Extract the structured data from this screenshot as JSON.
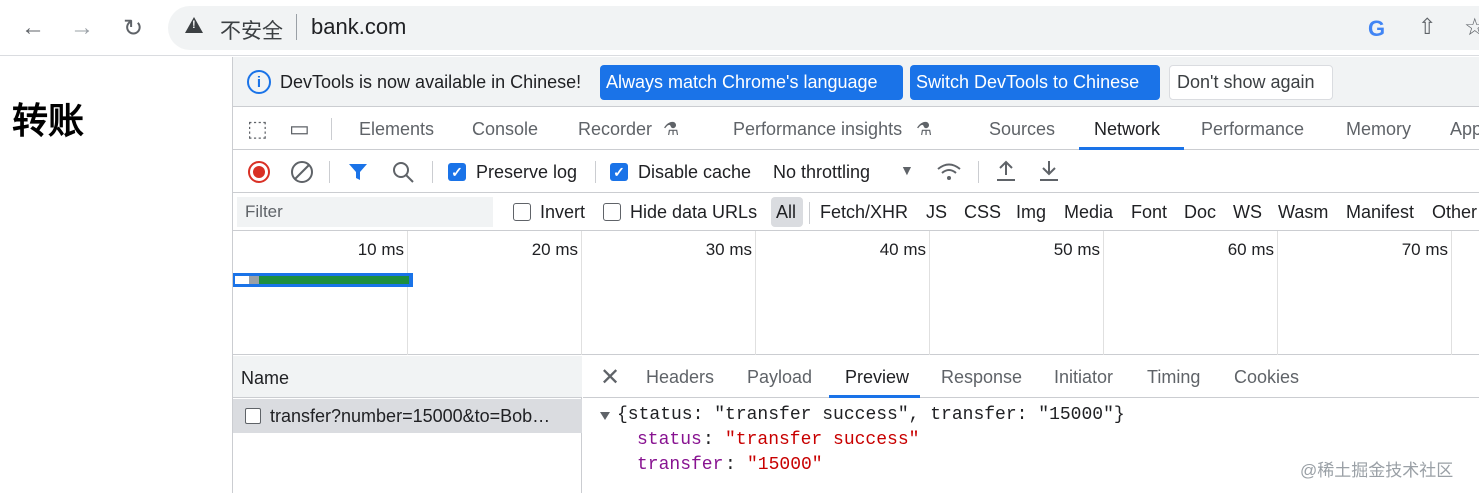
{
  "browser": {
    "security_label": "不安全",
    "url": "bank.com"
  },
  "page": {
    "title": "转账"
  },
  "devtools": {
    "infobar": {
      "message": "DevTools is now available in Chinese!",
      "btn_match": "Always match Chrome's language",
      "btn_switch": "Switch DevTools to Chinese",
      "btn_dismiss": "Don't show again"
    },
    "tabs": [
      "Elements",
      "Console",
      "Recorder",
      "Performance insights",
      "Sources",
      "Network",
      "Performance",
      "Memory",
      "App"
    ],
    "active_tab": "Network",
    "network_toolbar": {
      "preserve_log": "Preserve log",
      "disable_cache": "Disable cache",
      "throttling": "No throttling"
    },
    "filter": {
      "placeholder": "Filter",
      "invert": "Invert",
      "hide_data_urls": "Hide data URLs",
      "types": [
        "All",
        "Fetch/XHR",
        "JS",
        "CSS",
        "Img",
        "Media",
        "Font",
        "Doc",
        "WS",
        "Wasm",
        "Manifest",
        "Other"
      ]
    },
    "timeline": {
      "ticks": [
        "10 ms",
        "20 ms",
        "30 ms",
        "40 ms",
        "50 ms",
        "60 ms",
        "70 ms"
      ]
    },
    "requests": {
      "column_name": "Name",
      "rows": [
        {
          "name": "transfer?number=15000&to=Bob…"
        }
      ]
    },
    "detail": {
      "tabs": [
        "Headers",
        "Payload",
        "Preview",
        "Response",
        "Initiator",
        "Timing",
        "Cookies"
      ],
      "active_tab": "Preview",
      "preview": {
        "summary": "{status: \"transfer success\", transfer: \"15000\"}",
        "status_key": "status",
        "status_value": "\"transfer success\"",
        "transfer_key": "transfer",
        "transfer_value": "\"15000\""
      }
    }
  },
  "watermark": "@稀土掘金技术社区",
  "colors": {
    "accent": "#1a73e8",
    "record_red": "#d93025",
    "json_key": "#881391",
    "json_string": "#c80000"
  }
}
